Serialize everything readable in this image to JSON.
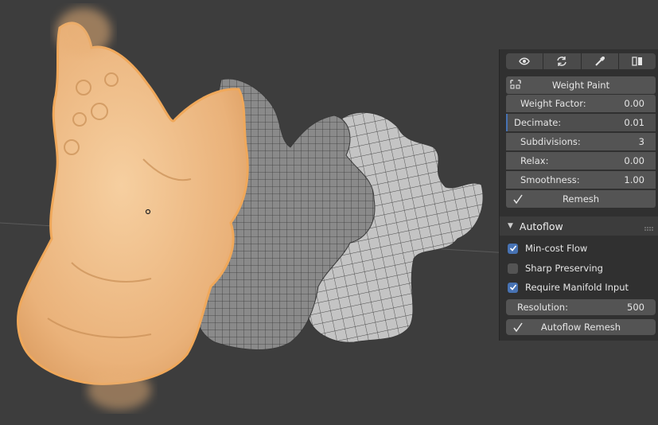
{
  "viewport": {
    "description_icons": [
      "gargoyle-mesh-orange",
      "gargoyle-mesh-quad",
      "gargoyle-mesh-flow"
    ]
  },
  "toolbar": {
    "icons": [
      "eye-icon",
      "refresh-icon",
      "eyedropper-icon",
      "split-view-icon"
    ]
  },
  "quad_panel": {
    "weight_paint_label": "Weight Paint",
    "properties": [
      {
        "label": "Weight Factor:",
        "value": "0.00"
      },
      {
        "label": "Decimate:",
        "value": "0.01"
      },
      {
        "label": "Subdivisions:",
        "value": "3"
      },
      {
        "label": "Relax:",
        "value": "0.00"
      },
      {
        "label": "Smoothness:",
        "value": "1.00"
      }
    ],
    "remesh_label": "Remesh"
  },
  "autoflow": {
    "title": "Autoflow",
    "options": [
      {
        "label": "Min-cost Flow",
        "checked": true
      },
      {
        "label": "Sharp Preserving",
        "checked": false
      },
      {
        "label": "Require Manifold Input",
        "checked": true
      }
    ],
    "resolution_label": "Resolution:",
    "resolution_value": "500",
    "button_label": "Autoflow Remesh"
  },
  "colors": {
    "accent": "#4772b3",
    "selection": "#f0a85a",
    "panel": "#303030",
    "button": "#545454"
  }
}
